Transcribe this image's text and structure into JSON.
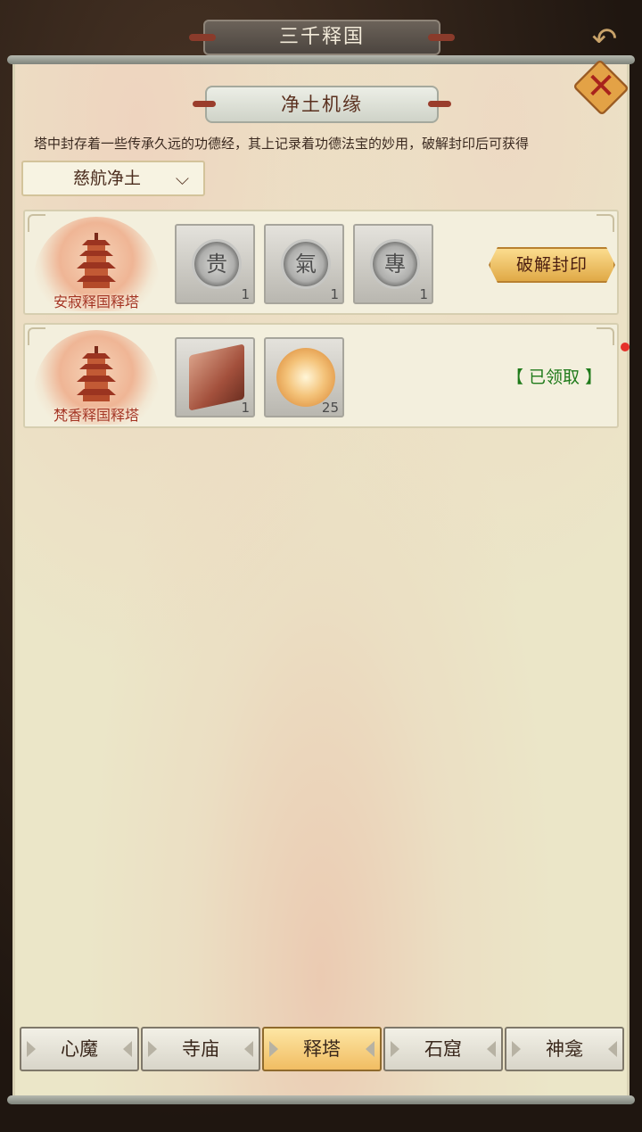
{
  "header": {
    "title": "三千释国",
    "back_icon": "back-arrow-icon"
  },
  "panel": {
    "title": "净土机缘",
    "close_icon": "close-icon",
    "description": "塔中封存着一些传承久远的功德经，其上记录着功德法宝的妙用，破解封印后可获得",
    "dropdown": {
      "selected": "慈航净土",
      "icon": "chevron-down-icon"
    }
  },
  "towers": [
    {
      "name": "安寂释国释塔",
      "items": [
        {
          "icon": "silver-seal-icon",
          "glyph": "贵",
          "count": "1"
        },
        {
          "icon": "silver-seal-icon",
          "glyph": "氣",
          "count": "1"
        },
        {
          "icon": "silver-seal-icon",
          "glyph": "專",
          "count": "1"
        }
      ],
      "action_label": "破解封印"
    },
    {
      "name": "梵香释国释塔",
      "items": [
        {
          "icon": "scripture-book-icon",
          "count": "1"
        },
        {
          "icon": "golden-lotus-icon",
          "count": "25"
        }
      ],
      "status_label": "【 已领取 】"
    }
  ],
  "tabs": [
    {
      "label": "心魔",
      "active": false
    },
    {
      "label": "寺庙",
      "active": false
    },
    {
      "label": "释塔",
      "active": true
    },
    {
      "label": "石窟",
      "active": false
    },
    {
      "label": "神龛",
      "active": false
    }
  ],
  "colors": {
    "parchment": "#ebe6c8",
    "accent_gold": "#e0a946",
    "claimed_green": "#1f7a1a",
    "tower_red": "#a33422"
  }
}
